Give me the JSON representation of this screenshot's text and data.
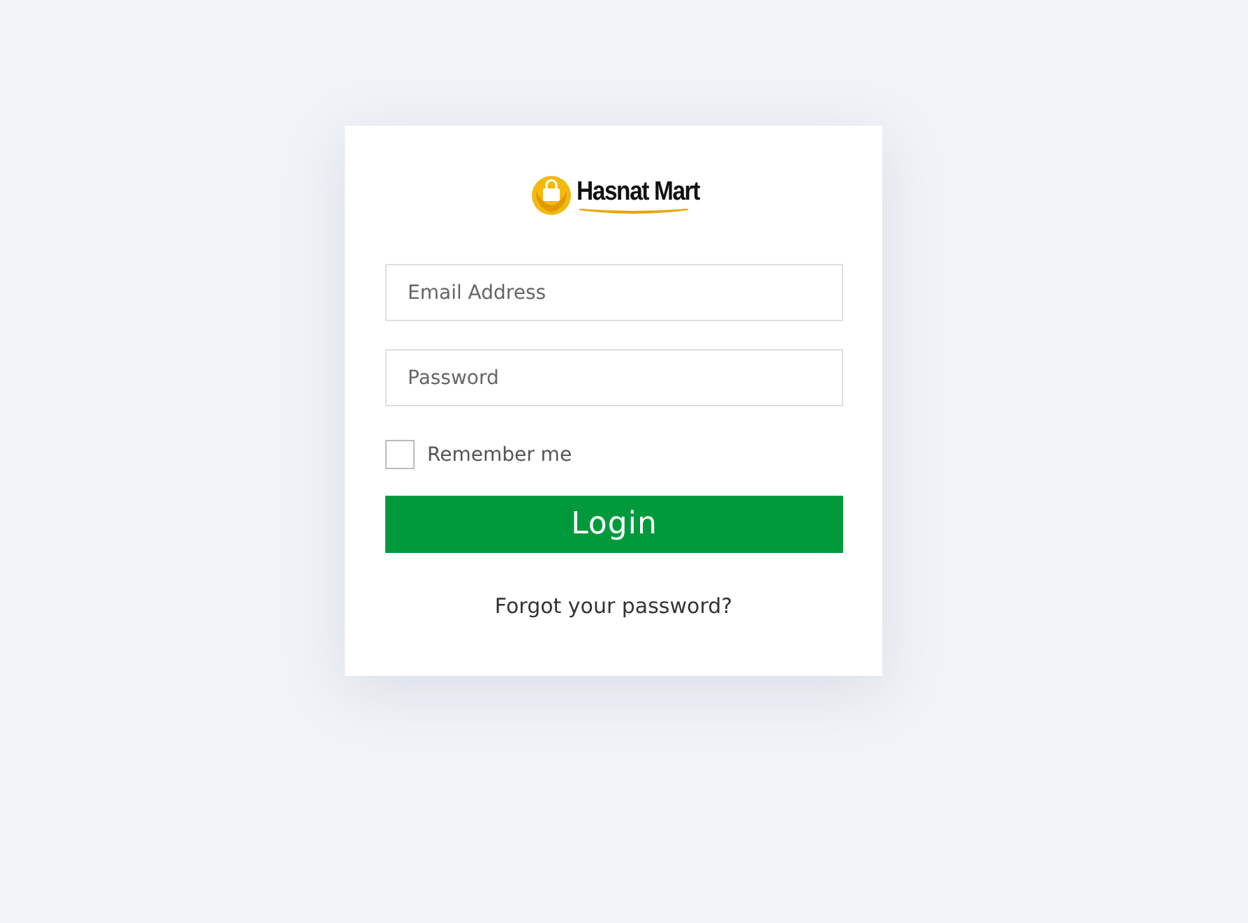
{
  "logo": {
    "text": "Hasnat Mart"
  },
  "email": {
    "placeholder": "Email Address"
  },
  "password": {
    "placeholder": "Password"
  },
  "remember": {
    "label": "Remember me",
    "checked": false
  },
  "login_button": {
    "label": "Login"
  },
  "forgot_link": {
    "label": "Forgot your password?"
  }
}
